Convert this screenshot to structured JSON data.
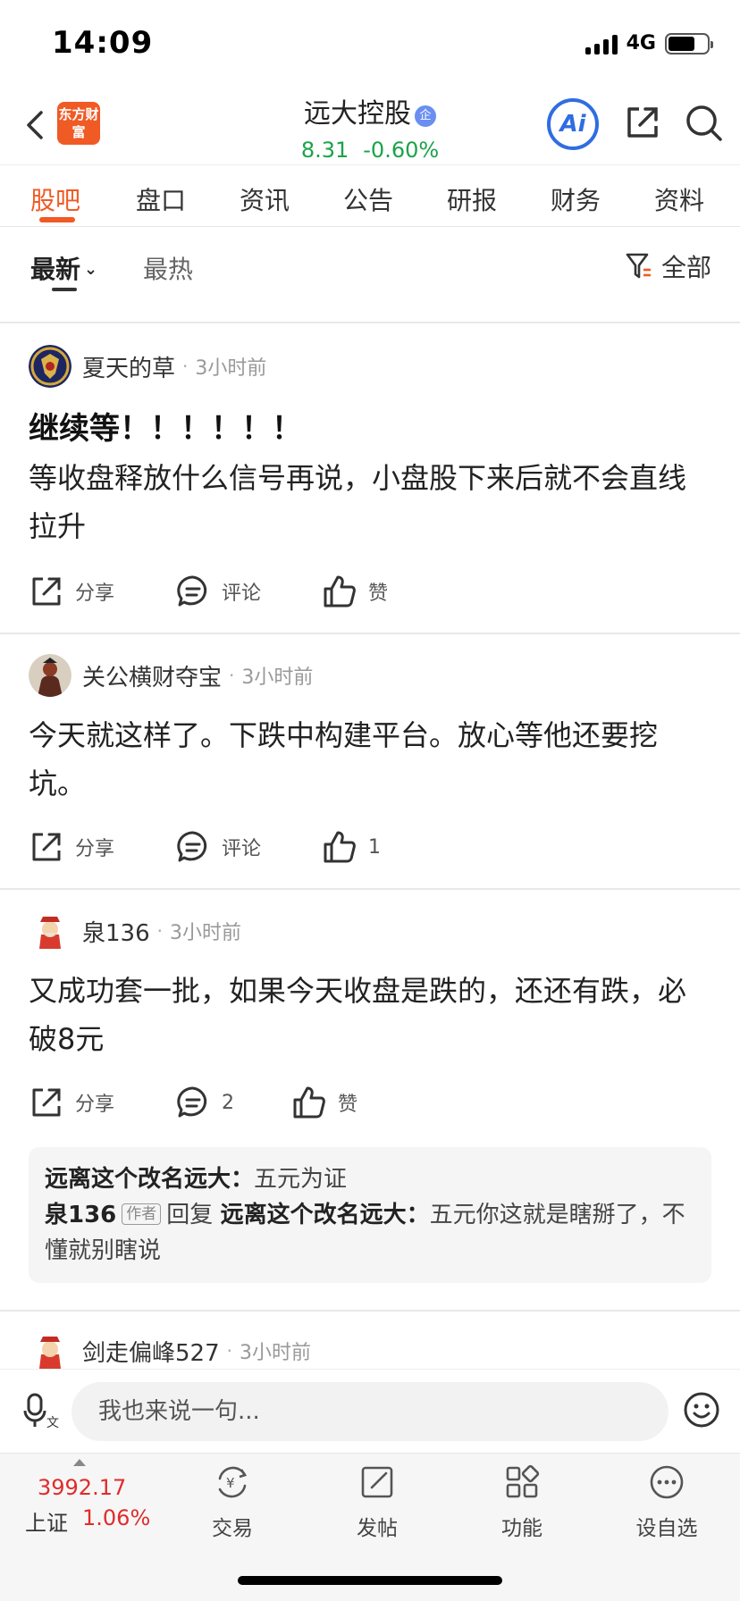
{
  "status_bar": {
    "time": "14:09",
    "network": "4G"
  },
  "header": {
    "logo_text": "东方财富",
    "stock_name": "远大控股",
    "verified_badge": "企",
    "price": "8.31",
    "change_pct": "-0.60%",
    "ai_label": "Ai"
  },
  "tabs": [
    "股吧",
    "盘口",
    "资讯",
    "公告",
    "研报",
    "财务",
    "资料"
  ],
  "sort": {
    "latest": "最新",
    "hot": "最热",
    "filter_label": "全部"
  },
  "posts": [
    {
      "author": "夏天的草",
      "time": "3小时前",
      "title": "继续等！！！！！！",
      "body": "等收盘释放什么信号再说，小盘股下来后就不会直线拉升",
      "share": "分享",
      "comment": "评论",
      "like": "赞"
    },
    {
      "author": "关公横财夺宝",
      "time": "3小时前",
      "body": "今天就这样了。下跌中构建平台。放心等他还要挖坑。",
      "share": "分享",
      "comment": "评论",
      "like": "1"
    },
    {
      "author": "泉136",
      "time": "3小时前",
      "body": "又成功套一批，如果今天收盘是跌的，还还有跌，必破8元",
      "share": "分享",
      "comment": "2",
      "like": "赞",
      "replies": {
        "r1_user": "远离这个改名远大：",
        "r1_text": "五元为证",
        "r2_user": "泉136",
        "r2_tag": "作者",
        "r2_verb": "回复",
        "r2_target": "远离这个改名远大：",
        "r2_text": "五元你这就是瞎掰了，不懂就别瞎说"
      }
    },
    {
      "author": "剑走偏峰527",
      "time": "3小时前"
    }
  ],
  "comment_input": {
    "placeholder": "我也来说一句..."
  },
  "bottom_nav": {
    "index_value": "3992.17",
    "index_name": "上证",
    "index_pct": "1.06%",
    "items": [
      "交易",
      "发帖",
      "功能",
      "设自选"
    ]
  }
}
